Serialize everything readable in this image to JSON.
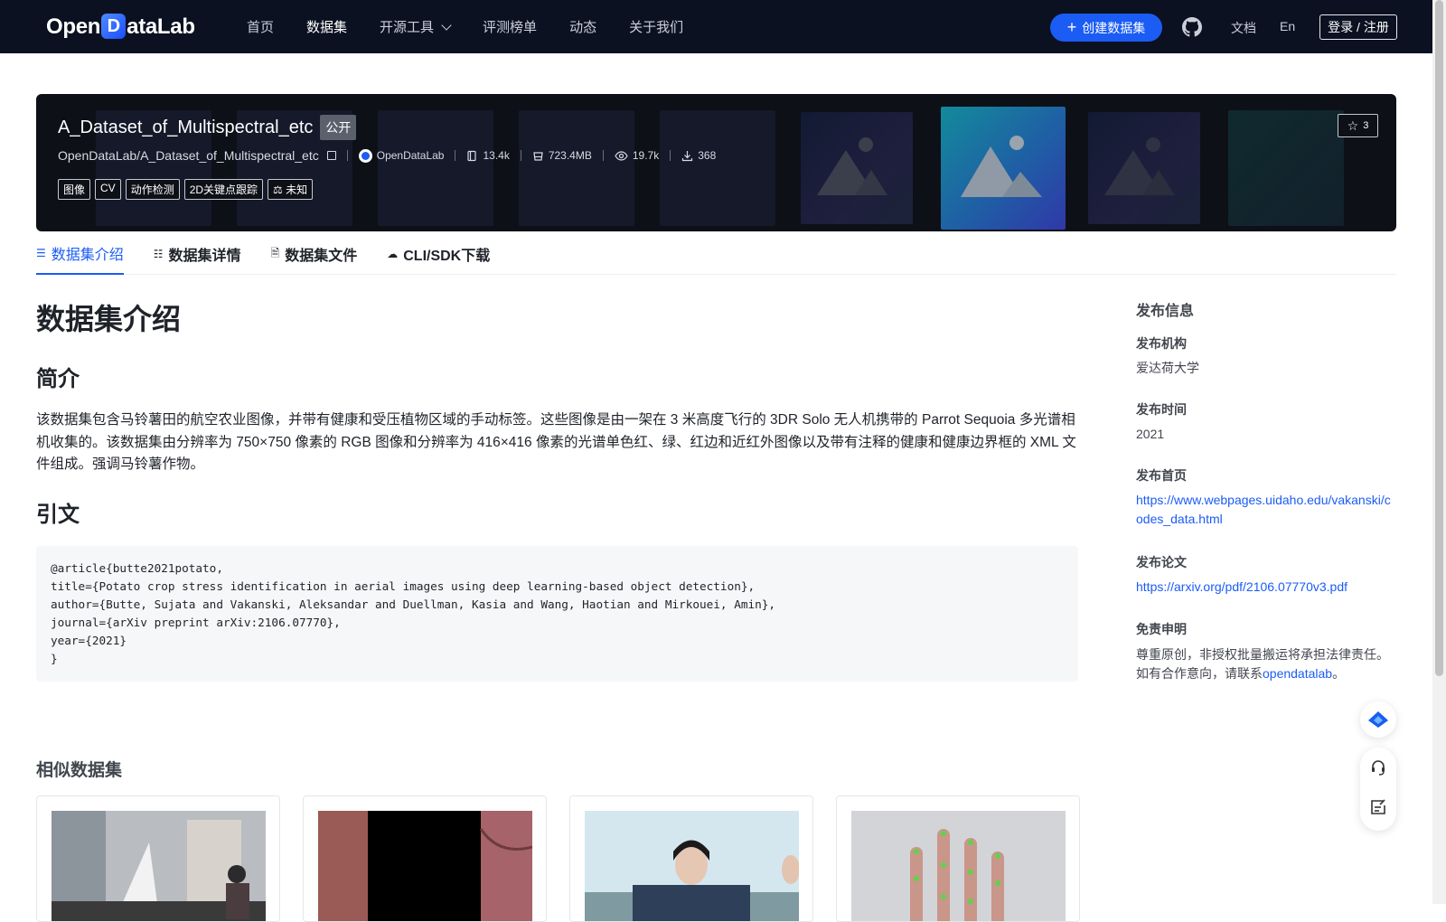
{
  "nav": {
    "logo_prefix": "Open",
    "logo_d": "D",
    "logo_suffix": "ataLab",
    "links": [
      "首页",
      "数据集",
      "开源工具",
      "评测榜单",
      "动态",
      "关于我们"
    ],
    "active": "数据集",
    "create_label": "创建数据集",
    "docs_label": "文档",
    "lang_label": "En",
    "login_label": "登录 / 注册"
  },
  "dataset": {
    "name": "A_Dataset_of_Multispectral_etc",
    "visibility": "公开",
    "path": "OpenDataLab/A_Dataset_of_Multispectral_etc",
    "org": "OpenDataLab",
    "files": "13.4k",
    "size": "723.4MB",
    "views": "19.7k",
    "downloads": "368",
    "tags": [
      "图像",
      "CV",
      "动作检测",
      "2D关键点跟踪",
      "未知"
    ],
    "stars": "3"
  },
  "tabs": [
    "数据集介绍",
    "数据集详情",
    "数据集文件",
    "CLI/SDK下载"
  ],
  "content": {
    "heading": "数据集介绍",
    "intro_heading": "简介",
    "intro_text": "该数据集包含马铃薯田的航空农业图像，并带有健康和受压植物区域的手动标签。这些图像是由一架在 3 米高度飞行的 3DR Solo 无人机携带的 Parrot Sequoia 多光谱相机收集的。该数据集由分辨率为 750×750 像素的 RGB 图像和分辨率为 416×416 像素的光谱单色红、绿、红边和近红外图像以及带有注释的健康和健康边界框的 XML 文件组成。强调马铃薯作物。",
    "citation_heading": "引文",
    "citation": "@article{butte2021potato,\ntitle={Potato crop stress identification in aerial images using deep learning-based object detection},\nauthor={Butte, Sujata and Vakanski, Aleksandar and Duellman, Kasia and Wang, Haotian and Mirkouei, Amin},\njournal={arXiv preprint arXiv:2106.07770},\nyear={2021}\n}",
    "similar_heading": "相似数据集"
  },
  "sidebar": {
    "title": "发布信息",
    "org_label": "发布机构",
    "org_value": "爱达荷大学",
    "time_label": "发布时间",
    "time_value": "2021",
    "home_label": "发布首页",
    "home_url": "https://www.webpages.uidaho.edu/vakanski/codes_data.html",
    "paper_label": "发布论文",
    "paper_url": "https://arxiv.org/pdf/2106.07770v3.pdf",
    "disclaimer_label": "免责申明",
    "disclaimer_text": "尊重原创，非授权批量搬运将承担法律责任。如有合作意向，请联系",
    "disclaimer_link": "opendatalab",
    "disclaimer_end": "。"
  },
  "colors": {
    "nav_bg": "#0b1121",
    "accent": "#1b5cf5",
    "banner_bg": "#0d1017"
  }
}
